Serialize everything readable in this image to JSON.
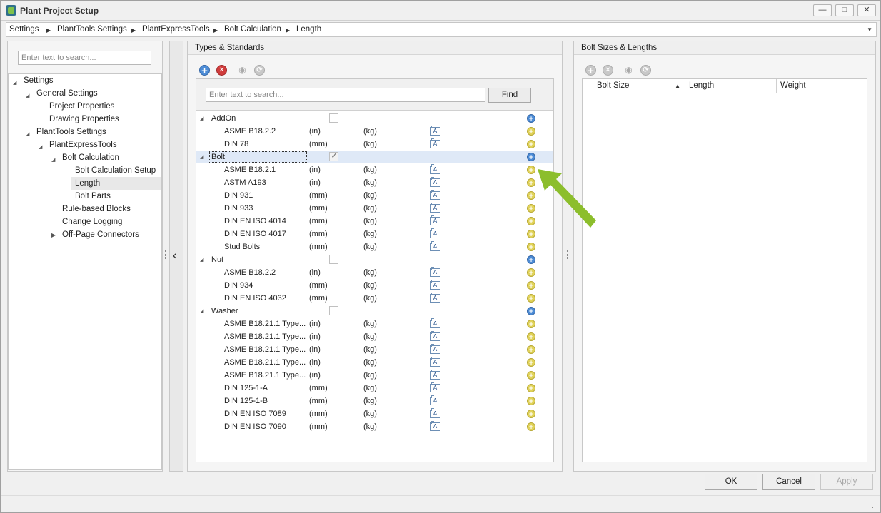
{
  "window": {
    "title": "Plant Project Setup",
    "minimize": "—",
    "maximize": "□",
    "close": "✕"
  },
  "breadcrumb": [
    "Settings",
    "PlantTools Settings",
    "PlantExpressTools",
    "Bolt Calculation",
    "Length"
  ],
  "left": {
    "search_placeholder": "Enter text to search...",
    "tree": [
      "Settings",
      "General Settings",
      "Project Properties",
      "Drawing Properties",
      "PlantTools Settings",
      "PlantExpressTools",
      "Bolt Calculation",
      "Bolt Calculation Setup",
      "Length",
      "Bolt Parts",
      "Rule-based Blocks",
      "Change Logging",
      "Off-Page Connectors"
    ]
  },
  "types": {
    "title": "Types & Standards",
    "search_placeholder": "Enter text to search...",
    "find_label": "Find",
    "a_icon": "A",
    "groups": [
      {
        "name": "AddOn",
        "checked": false,
        "rows": [
          {
            "name": "ASME B18.2.2",
            "unit": "(in)",
            "weight": "(kg)"
          },
          {
            "name": "DIN 78",
            "unit": "(mm)",
            "weight": "(kg)"
          }
        ]
      },
      {
        "name": "Bolt",
        "checked": true,
        "rows": [
          {
            "name": "ASME B18.2.1",
            "unit": "(in)",
            "weight": "(kg)"
          },
          {
            "name": "ASTM A193",
            "unit": "(in)",
            "weight": "(kg)"
          },
          {
            "name": "DIN 931",
            "unit": "(mm)",
            "weight": "(kg)"
          },
          {
            "name": "DIN 933",
            "unit": "(mm)",
            "weight": "(kg)"
          },
          {
            "name": "DIN EN ISO 4014",
            "unit": "(mm)",
            "weight": "(kg)"
          },
          {
            "name": "DIN EN ISO 4017",
            "unit": "(mm)",
            "weight": "(kg)"
          },
          {
            "name": "Stud Bolts",
            "unit": "(mm)",
            "weight": "(kg)"
          }
        ]
      },
      {
        "name": "Nut",
        "checked": false,
        "rows": [
          {
            "name": "ASME B18.2.2",
            "unit": "(in)",
            "weight": "(kg)"
          },
          {
            "name": "DIN 934",
            "unit": "(mm)",
            "weight": "(kg)"
          },
          {
            "name": "DIN EN ISO 4032",
            "unit": "(mm)",
            "weight": "(kg)"
          }
        ]
      },
      {
        "name": "Washer",
        "checked": false,
        "rows": [
          {
            "name": "ASME B18.21.1 Type...",
            "unit": "(in)",
            "weight": "(kg)"
          },
          {
            "name": "ASME B18.21.1 Type...",
            "unit": "(in)",
            "weight": "(kg)"
          },
          {
            "name": "ASME B18.21.1 Type...",
            "unit": "(in)",
            "weight": "(kg)"
          },
          {
            "name": "ASME B18.21.1 Type...",
            "unit": "(in)",
            "weight": "(kg)"
          },
          {
            "name": "ASME B18.21.1 Type...",
            "unit": "(in)",
            "weight": "(kg)"
          },
          {
            "name": "DIN 125-1-A",
            "unit": "(mm)",
            "weight": "(kg)"
          },
          {
            "name": "DIN 125-1-B",
            "unit": "(mm)",
            "weight": "(kg)"
          },
          {
            "name": "DIN EN ISO 7089",
            "unit": "(mm)",
            "weight": "(kg)"
          },
          {
            "name": "DIN EN ISO 7090",
            "unit": "(mm)",
            "weight": "(kg)"
          }
        ]
      }
    ]
  },
  "sizes": {
    "title": "Bolt Sizes & Lengths",
    "columns": [
      "Bolt Size",
      "Length",
      "Weight"
    ]
  },
  "buttons": {
    "ok": "OK",
    "cancel": "Cancel",
    "apply": "Apply"
  },
  "colors": {
    "accent_arrow": "#8cbe2c",
    "selection": "#dfe9f7",
    "add_blue": "#4d8cd6",
    "add_yellow": "#e1d35a",
    "remove_red": "#d03c3c"
  }
}
